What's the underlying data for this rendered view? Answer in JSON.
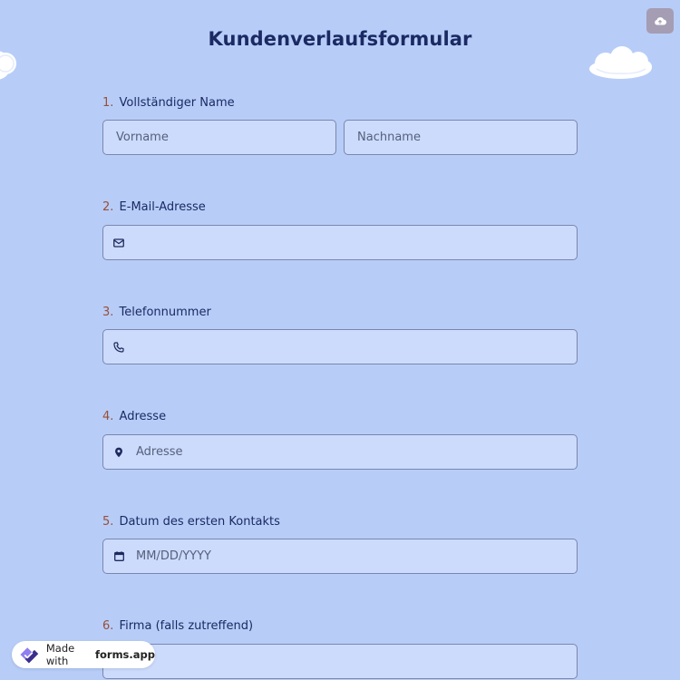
{
  "form": {
    "title": "Kundenverlaufsformular"
  },
  "questions": [
    {
      "number": "1.",
      "label": "Vollständiger Name",
      "fields": [
        {
          "placeholder": "Vorname"
        },
        {
          "placeholder": "Nachname"
        }
      ]
    },
    {
      "number": "2.",
      "label": "E-Mail-Adresse",
      "fields": [
        {
          "placeholder": "",
          "icon": "envelope-icon"
        }
      ]
    },
    {
      "number": "3.",
      "label": "Telefonnummer",
      "fields": [
        {
          "placeholder": "",
          "icon": "phone-icon"
        }
      ]
    },
    {
      "number": "4.",
      "label": "Adresse",
      "fields": [
        {
          "placeholder": "Adresse",
          "icon": "map-pin-icon"
        }
      ]
    },
    {
      "number": "5.",
      "label": "Datum des ersten Kontakts",
      "fields": [
        {
          "placeholder": "MM/DD/YYYY",
          "icon": "calendar-icon"
        }
      ]
    },
    {
      "number": "6.",
      "label": "Firma (falls zutreffend)",
      "fields": [
        {
          "placeholder": ""
        }
      ]
    }
  ],
  "badge": {
    "prefix": "Made with",
    "brand": "forms.app"
  },
  "icons": {
    "save": "cloud-upload-icon",
    "badge_logo": "forms-app-logo-icon"
  },
  "colors": {
    "background": "#b7cdf8",
    "field_bg": "#ccdbfc",
    "title": "#1b2a63",
    "number": "#9a4e37",
    "save_button": "#a59db3"
  }
}
